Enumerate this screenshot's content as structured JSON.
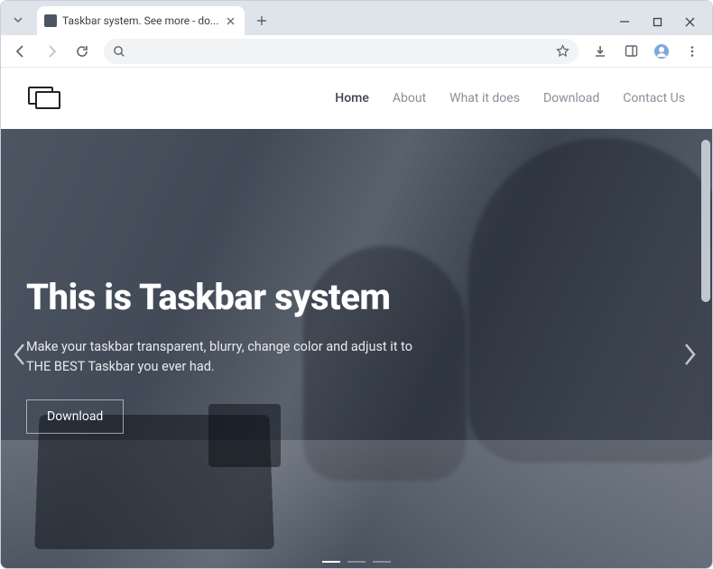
{
  "browser": {
    "tab_title": "Taskbar system. See more - do...",
    "window": {
      "minimize": "–",
      "maximize": "▢",
      "close": "✕"
    }
  },
  "nav": {
    "items": [
      {
        "label": "Home",
        "active": true
      },
      {
        "label": "About",
        "active": false
      },
      {
        "label": "What it does",
        "active": false
      },
      {
        "label": "Download",
        "active": false
      },
      {
        "label": "Contact Us",
        "active": false
      }
    ]
  },
  "hero": {
    "title": "This is Taskbar system",
    "subtitle": "Make your taskbar transparent, blurry, change color and adjust it to THE BEST Taskbar you ever had.",
    "button": "Download"
  },
  "carousel": {
    "dot_count": 3,
    "active_index": 0
  }
}
